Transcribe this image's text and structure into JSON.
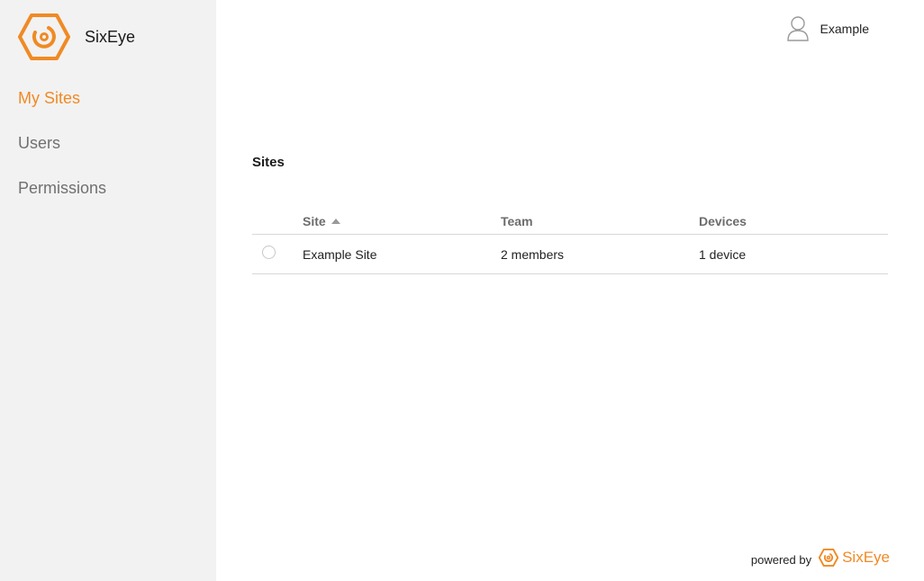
{
  "brand": {
    "name": "SixEye"
  },
  "sidebar": {
    "items": [
      {
        "label": "My Sites",
        "active": true
      },
      {
        "label": "Users",
        "active": false
      },
      {
        "label": "Permissions",
        "active": false
      }
    ]
  },
  "header": {
    "user_name": "Example"
  },
  "main": {
    "title": "Sites",
    "table": {
      "columns": [
        "Site",
        "Team",
        "Devices"
      ],
      "sort_column": "Site",
      "sort_direction": "ascending",
      "rows": [
        {
          "site": "Example Site",
          "team": "2 members",
          "devices": "1 device"
        }
      ]
    }
  },
  "footer": {
    "powered_by": "powered by",
    "brand": "SixEye"
  },
  "colors": {
    "accent": "#f08a24",
    "sidebar_bg": "#f2f2f2",
    "muted_text": "#707070"
  },
  "icons": {
    "logo": "sixeye-hex-logo",
    "user": "user-avatar-icon",
    "sort": "sort-asc-icon"
  }
}
